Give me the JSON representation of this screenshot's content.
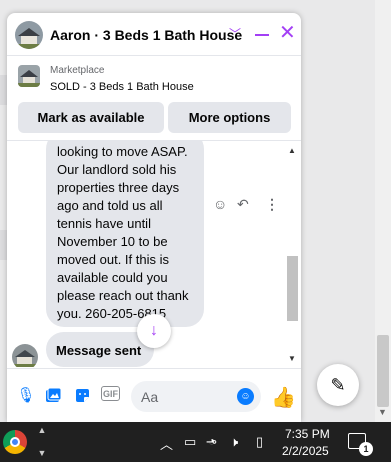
{
  "chat": {
    "title": "Aaron · 3 Beds 1 Bath House",
    "marketplace_label": "Marketplace",
    "listing": "SOLD - 3 Beds 1 Bath House",
    "mark_available": "Mark as available",
    "more_options": "More options",
    "message_lines": [
      "looking to move ASAP.",
      "Our landlord sold his",
      "properties three days",
      "ago and told us all",
      "tennis have until",
      "November 10 to be",
      "moved out. If this is",
      "available could you",
      "please reach out thank",
      "you. 260-205-6815"
    ],
    "sent_status": "Message sent",
    "input_placeholder": "Aa",
    "gif_label": "GIF",
    "accent_color": "#a33ff5",
    "messenger_blue": "#0a7cff",
    "icons": [
      "chevron-down-icon",
      "minimize-icon",
      "close-icon",
      "react-icon",
      "reply-icon",
      "more-icon",
      "scroll-down-icon",
      "microphone-icon",
      "photo-icon",
      "sticker-icon",
      "gif-icon",
      "emoji-icon",
      "like-icon",
      "new-message-icon"
    ]
  },
  "taskbar": {
    "time": "7:35 PM",
    "date": "2/2/2025",
    "notification_count": "1",
    "icons": [
      "chrome-icon",
      "chevron-up-icon",
      "monitor-icon",
      "link-icon",
      "wifi-icon",
      "speaker-icon",
      "battery-icon",
      "notification-icon"
    ]
  }
}
